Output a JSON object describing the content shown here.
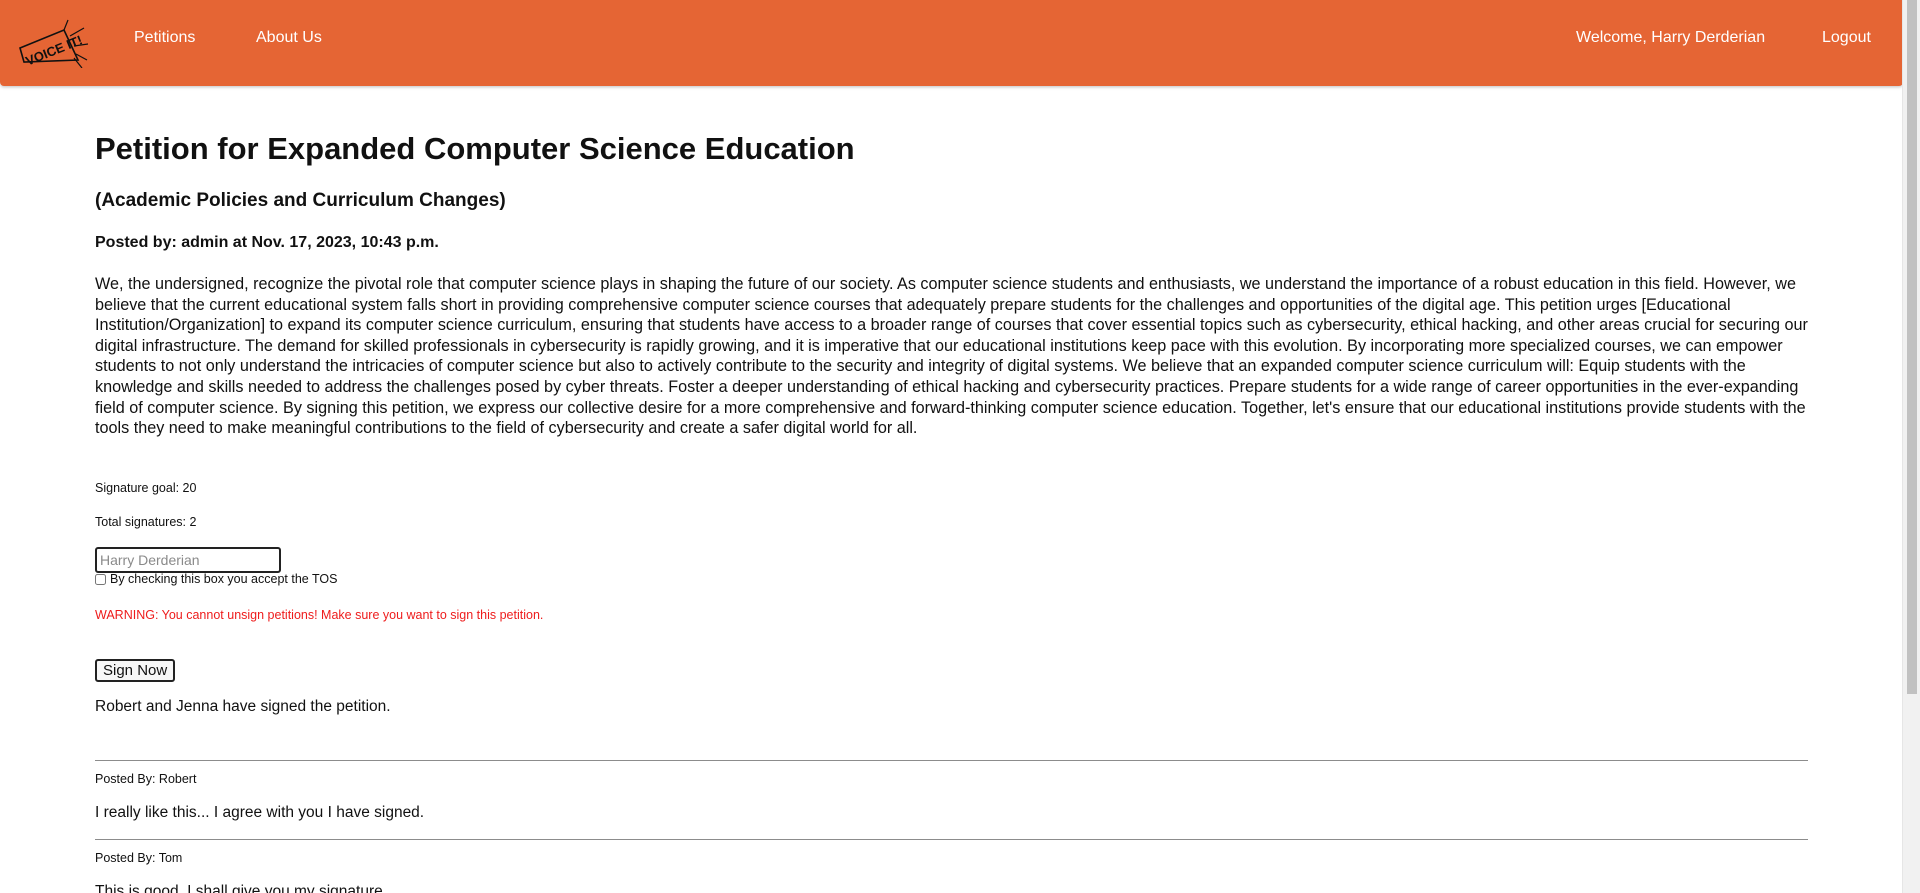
{
  "navbar": {
    "logo_text": "VOICE IT!",
    "links": [
      {
        "label": "Petitions"
      },
      {
        "label": "About Us"
      }
    ],
    "welcome": "Welcome, Harry Derderian",
    "logout": "Logout"
  },
  "petition": {
    "title": "Petition for Expanded Computer Science Education",
    "category": "(Academic Policies and Curriculum Changes)",
    "posted_by": "Posted by: admin at Nov. 17, 2023, 10:43 p.m.",
    "body": "We, the undersigned, recognize the pivotal role that computer science plays in shaping the future of our society. As computer science students and enthusiasts, we understand the importance of a robust education in this field. However, we believe that the current educational system falls short in providing comprehensive computer science courses that adequately prepare students for the challenges and opportunities of the digital age. This petition urges [Educational Institution/Organization] to expand its computer science curriculum, ensuring that students have access to a broader range of courses that cover essential topics such as cybersecurity, ethical hacking, and other areas crucial for securing our digital infrastructure. The demand for skilled professionals in cybersecurity is rapidly growing, and it is imperative that our educational institutions keep pace with this evolution. By incorporating more specialized courses, we can empower students to not only understand the intricacies of computer science but also to actively contribute to the security and integrity of digital systems. We believe that an expanded computer science curriculum will: Equip students with the knowledge and skills needed to address the challenges posed by cyber threats. Foster a deeper understanding of ethical hacking and cybersecurity practices. Prepare students for a wide range of career opportunities in the ever-expanding field of computer science. By signing this petition, we express our collective desire for a more comprehensive and forward-thinking computer science education. Together, let's ensure that our educational institutions provide students with the tools they need to make meaningful contributions to the field of cybersecurity and create a safer digital world for all.",
    "signature_goal": "Signature goal: 20",
    "total_signatures": "Total signatures: 2"
  },
  "sign_form": {
    "name_placeholder": "Harry Derderian",
    "tos_label": "By checking this box you accept the TOS",
    "tos_checked": false,
    "warning": "WARNING: You cannot unsign petitions! Make sure you want to sign this petition.",
    "sign_button": "Sign Now"
  },
  "signers_text": "Robert and Jenna have signed the petition.",
  "comments": [
    {
      "author": "Posted By: Robert",
      "text": "I really like this... I agree with you I have signed."
    },
    {
      "author": "Posted By: Tom",
      "text": "This is good. I shall give you my signature."
    }
  ],
  "colors": {
    "navbar": "#e56534",
    "warning": "#ee1c1c"
  }
}
